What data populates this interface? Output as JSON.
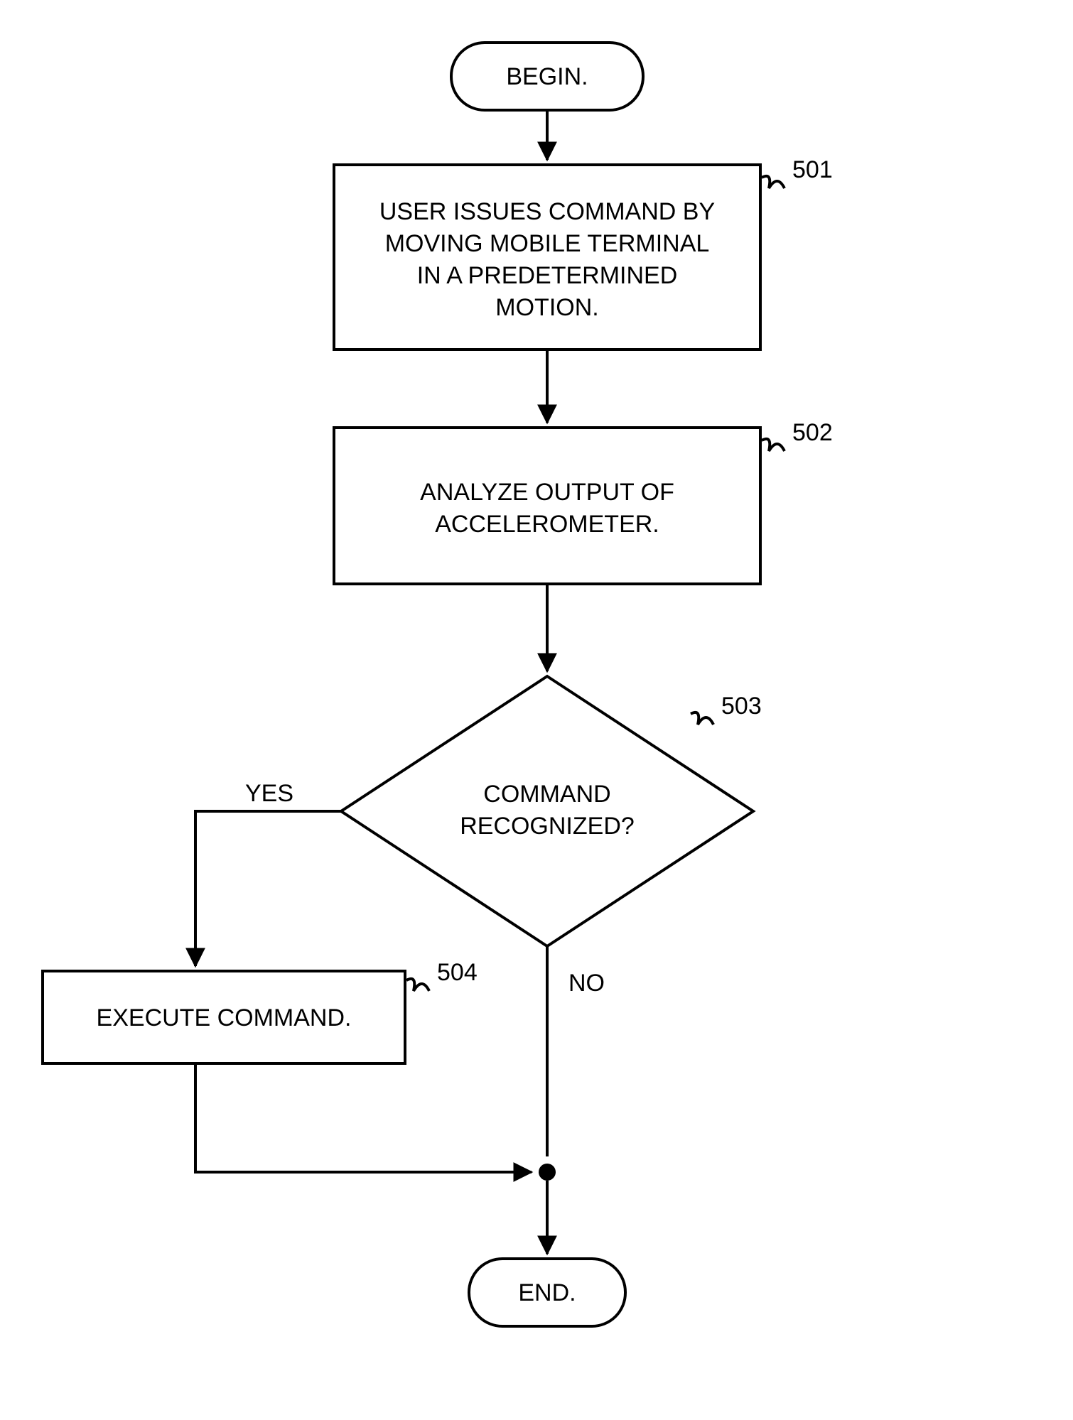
{
  "chart_data": {
    "type": "flowchart",
    "nodes": [
      {
        "id": "begin",
        "type": "terminator",
        "label": "BEGIN."
      },
      {
        "id": "n501",
        "type": "process",
        "ref": "501",
        "label": "USER ISSUES COMMAND BY MOVING MOBILE TERMINAL IN A PREDETERMINED MOTION."
      },
      {
        "id": "n502",
        "type": "process",
        "ref": "502",
        "label": "ANALYZE OUTPUT OF ACCELEROMETER."
      },
      {
        "id": "n503",
        "type": "decision",
        "ref": "503",
        "label": "COMMAND RECOGNIZED?"
      },
      {
        "id": "n504",
        "type": "process",
        "ref": "504",
        "label": "EXECUTE COMMAND."
      },
      {
        "id": "end",
        "type": "terminator",
        "label": "END."
      }
    ],
    "edges": [
      {
        "from": "begin",
        "to": "n501"
      },
      {
        "from": "n501",
        "to": "n502"
      },
      {
        "from": "n502",
        "to": "n503"
      },
      {
        "from": "n503",
        "to": "n504",
        "label": "YES"
      },
      {
        "from": "n503",
        "to": "end",
        "label": "NO"
      },
      {
        "from": "n504",
        "to": "end"
      }
    ]
  },
  "begin": {
    "label": "BEGIN."
  },
  "end": {
    "label": "END."
  },
  "n501": {
    "ref": "501",
    "l1": "USER ISSUES COMMAND BY",
    "l2": "MOVING MOBILE TERMINAL",
    "l3": "IN A PREDETERMINED",
    "l4": "MOTION."
  },
  "n502": {
    "ref": "502",
    "l1": "ANALYZE OUTPUT OF",
    "l2": "ACCELEROMETER."
  },
  "n503": {
    "ref": "503",
    "l1": "COMMAND",
    "l2": "RECOGNIZED?"
  },
  "n504": {
    "ref": "504",
    "l1": "EXECUTE COMMAND."
  },
  "edges": {
    "yes": "YES",
    "no": "NO"
  }
}
